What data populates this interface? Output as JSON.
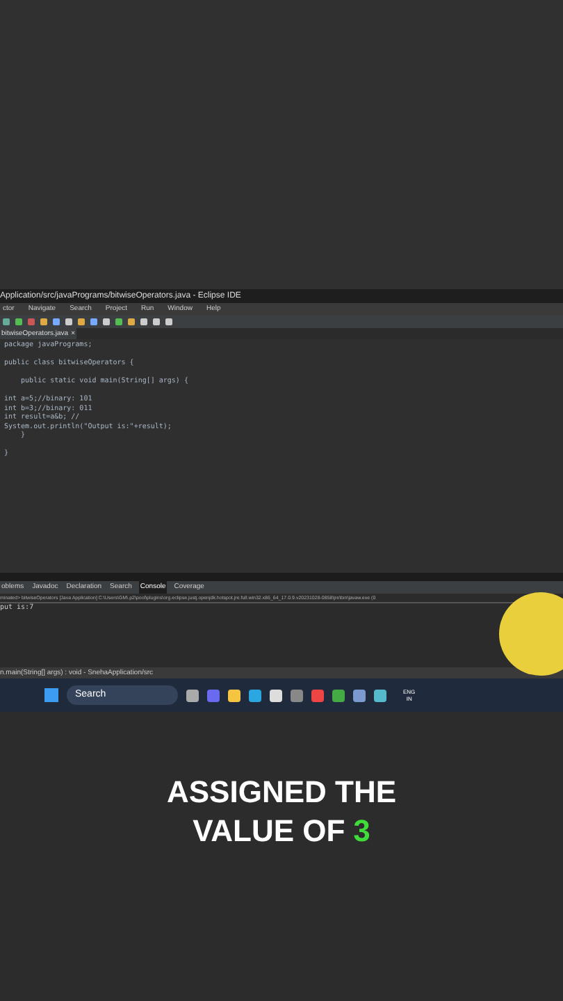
{
  "window": {
    "title": "Application/src/javaPrograms/bitwiseOperators.java - Eclipse IDE"
  },
  "menu": [
    "ctor",
    "Navigate",
    "Search",
    "Project",
    "Run",
    "Window",
    "Help"
  ],
  "editor_tab": {
    "label": "bitwiseOperators.java",
    "close": "×"
  },
  "code_blocks": [
    [
      "package javaPrograms;"
    ],
    [
      "public class bitwiseOperators {"
    ],
    [
      "    public static void main(String[] args) {"
    ],
    [
      "int a=5;//binary: 101",
      "int b=3;//binary: 011",
      "int result=a&b; //",
      "System.out.println(\"Output is:\"+result);",
      "    }"
    ],
    [
      "}"
    ]
  ],
  "bottom_tabs": [
    {
      "label": "oblems",
      "selected": false
    },
    {
      "label": "Javadoc",
      "selected": false
    },
    {
      "label": "Declaration",
      "selected": false
    },
    {
      "label": "Search",
      "selected": false
    },
    {
      "label": "Console",
      "selected": true
    },
    {
      "label": "Coverage",
      "selected": false
    }
  ],
  "console": {
    "header": "minated> bitwiseOperators [Java Application] C:\\Users\\GM\\.p2\\pool\\plugins\\org.eclipse.justj.openjdk.hotspot.jre.full.win32.x86_64_17.0.9.v20231028-0858\\jre\\bin\\javaw.exe (0",
    "output": "put is:7"
  },
  "status_bar": "n.main(String[] args) : void - SnehaApplication/src",
  "taskbar": {
    "search": "Search",
    "language": "ENG",
    "region": "IN"
  },
  "caption": {
    "line_1": "ASSIGNED THE",
    "line_2": "VALUE OF",
    "highlight": "3"
  }
}
